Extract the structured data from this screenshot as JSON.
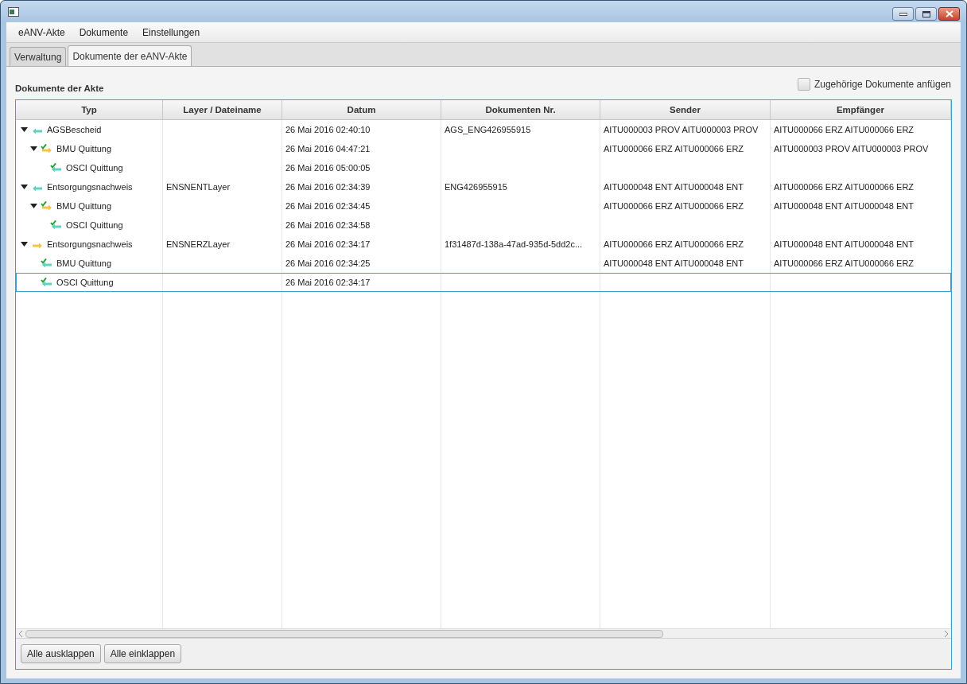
{
  "menu": [
    "eANV-Akte",
    "Dokumente",
    "Einstellungen"
  ],
  "tabs": [
    {
      "label": "Verwaltung",
      "selected": false
    },
    {
      "label": "Dokumente der  eANV-Akte",
      "selected": true
    }
  ],
  "section_title": "Dokumente der Akte",
  "attach_option": {
    "label": "Zugehörige Dokumente anfügen",
    "checked": false
  },
  "columns": [
    "Typ",
    "Layer / Dateiname",
    "Datum",
    "Dokumenten Nr.",
    "Sender",
    "Empfänger"
  ],
  "rows": [
    {
      "kind": "incoming",
      "typ": "AGSBescheid",
      "datum": "26 Mai 2016 02:40:10",
      "nr": "AGS_ENG426955915",
      "sender": "AITU000003 PROV AITU000003 PROV",
      "empfaenger": "AITU000066 ERZ AITU000066 ERZ",
      "selected": false,
      "expanded": true,
      "children": [
        {
          "kind": "receipt-outgoing",
          "typ": "BMU Quittung",
          "datum": "26 Mai 2016 04:47:21",
          "sender": "AITU000066 ERZ AITU000066 ERZ",
          "empfaenger": "AITU000003 PROV AITU000003 PROV",
          "selected": false,
          "expanded": true,
          "children": [
            {
              "kind": "receipt-incoming",
              "typ": "OSCI Quittung",
              "datum": "26 Mai 2016 05:00:05",
              "selected": false
            }
          ]
        }
      ]
    },
    {
      "kind": "incoming",
      "typ": "Entsorgungsnachweis",
      "layer": "ENSNENTLayer",
      "datum": "26 Mai 2016 02:34:39",
      "nr": "ENG426955915",
      "sender": "AITU000048 ENT AITU000048 ENT",
      "empfaenger": "AITU000066 ERZ AITU000066 ERZ",
      "selected": false,
      "expanded": true,
      "children": [
        {
          "kind": "receipt-outgoing",
          "typ": "BMU Quittung",
          "datum": "26 Mai 2016 02:34:45",
          "sender": "AITU000066 ERZ AITU000066 ERZ",
          "empfaenger": "AITU000048 ENT AITU000048 ENT",
          "selected": false,
          "expanded": true,
          "children": [
            {
              "kind": "receipt-incoming",
              "typ": "OSCI Quittung",
              "datum": "26 Mai 2016 02:34:58",
              "selected": false
            }
          ]
        }
      ]
    },
    {
      "kind": "outgoing",
      "typ": "Entsorgungsnachweis",
      "layer": "ENSNERZLayer",
      "datum": "26 Mai 2016 02:34:17",
      "nr": "1f31487d-138a-47ad-935d-5dd2c...",
      "sender": "AITU000066 ERZ AITU000066 ERZ",
      "empfaenger": "AITU000048 ENT AITU000048 ENT",
      "selected": false,
      "expanded": true,
      "children": [
        {
          "kind": "receipt-incoming",
          "typ": "BMU Quittung",
          "datum": "26 Mai 2016 02:34:25",
          "sender": "AITU000048 ENT AITU000048 ENT",
          "empfaenger": "AITU000066 ERZ AITU000066 ERZ",
          "selected": false
        },
        {
          "kind": "receipt-incoming",
          "typ": "OSCI Quittung",
          "datum": "26 Mai 2016 02:34:17",
          "selected": true
        }
      ]
    }
  ],
  "buttons": [
    "Alle ausklappen",
    "Alle einklappen"
  ]
}
